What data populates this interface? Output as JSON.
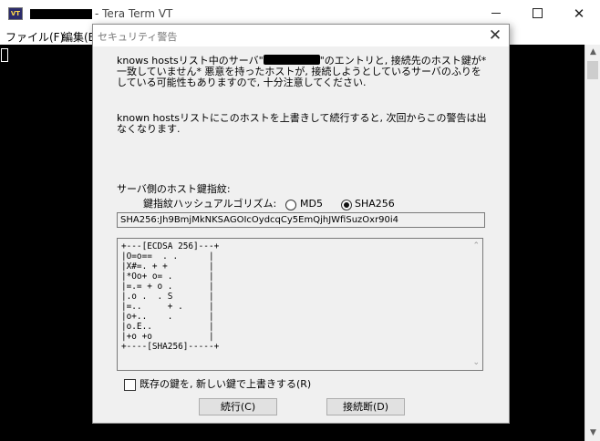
{
  "main_window": {
    "app_icon_text": "VT",
    "title": "- Tera Term VT",
    "controls": {
      "minimize": "",
      "maximize": "",
      "close": "✕"
    },
    "menu": {
      "file": "ファイル(F)",
      "edit": "編集(E"
    },
    "scroll_up": "▲",
    "scroll_down": "▼"
  },
  "dialog": {
    "title": "セキュリティ警告",
    "close": "✕",
    "message1_a": "knows hostsリスト中のサーバ\"",
    "message1_b": "\"のエントリと, 接続先のホスト鍵が*一致していません* 悪意を持ったホストが, 接続しようとしているサーバのふりをしている可能性もありますので, 十分注意してください.",
    "message2": "known hostsリストにこのホストを上書きして続行すると, 次回からこの警告は出なくなります.",
    "fingerprint_label": "サーバ側のホスト鍵指紋:",
    "hash_algorithm_label": "鍵指紋ハッシュアルゴリズム:",
    "radio_md5": "MD5",
    "radio_sha256": "SHA256",
    "selected_algorithm": "SHA256",
    "fingerprint_value": "SHA256:Jh9BmjMkNKSAGOIcOydcqCy5EmQjhJWfiSuzOxr90i4",
    "randomart": "+---[ECDSA 256]---+\n|O=o==  . .      |\n|X#=. + +        |\n|*Oo+ o= .       |\n|=.= + o .       |\n|.o .  . S       |\n|=..     + .     |\n|o+..    .       |\n|o.E..           |\n|+o +o           |\n+----[SHA256]-----+",
    "art_scroll_up": "⌃",
    "art_scroll_down": "⌄",
    "overwrite_checkbox_label": "既存の鍵を, 新しい鍵で上書きする(R)",
    "overwrite_checked": false,
    "continue_button": "続行(C)",
    "disconnect_button": "接続断(D)"
  }
}
